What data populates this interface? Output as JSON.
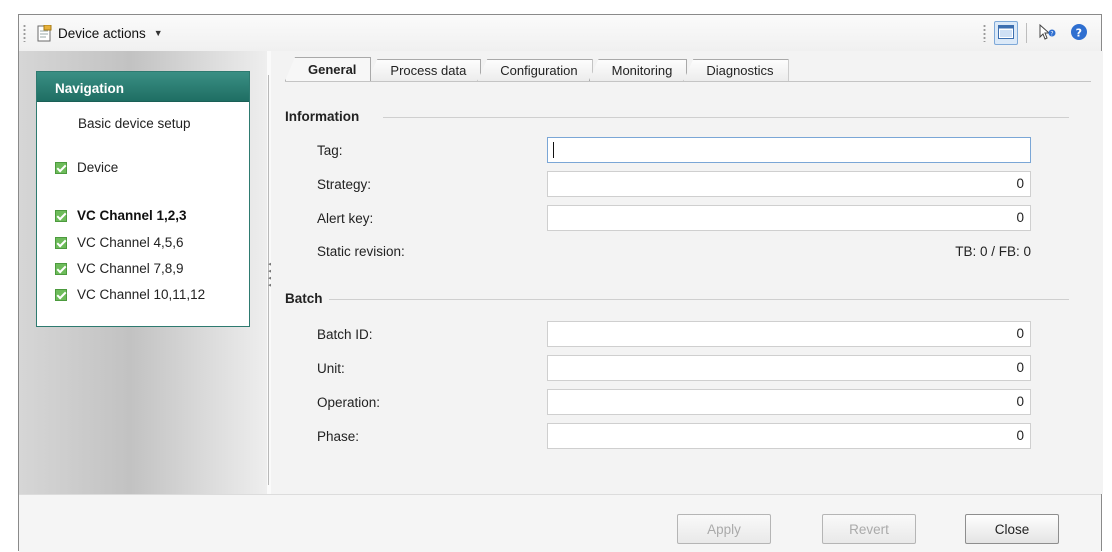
{
  "toolbar": {
    "device_actions_label": "Device actions",
    "device_actions_icon": "document-icon",
    "right_icons": [
      "window-layout-icon",
      "pointer-help-icon",
      "help-icon"
    ]
  },
  "navigation": {
    "title": "Navigation",
    "items": [
      {
        "label": "Basic device setup",
        "checked": false,
        "bold": false
      },
      {
        "label": "Device",
        "checked": true,
        "bold": false
      },
      {
        "label": "VC Channel 1,2,3",
        "checked": true,
        "bold": true
      },
      {
        "label": "VC Channel 4,5,6",
        "checked": true,
        "bold": false
      },
      {
        "label": "VC Channel 7,8,9",
        "checked": true,
        "bold": false
      },
      {
        "label": "VC Channel 10,11,12",
        "checked": true,
        "bold": false
      }
    ]
  },
  "tabs": [
    {
      "label": "General",
      "active": true
    },
    {
      "label": "Process data",
      "active": false
    },
    {
      "label": "Configuration",
      "active": false
    },
    {
      "label": "Monitoring",
      "active": false
    },
    {
      "label": "Diagnostics",
      "active": false
    }
  ],
  "information": {
    "title": "Information",
    "tag_label": "Tag:",
    "tag_value": "",
    "strategy_label": "Strategy:",
    "strategy_value": "0",
    "alert_key_label": "Alert key:",
    "alert_key_value": "0",
    "static_revision_label": "Static revision:",
    "static_revision_value": "TB: 0 / FB: 0"
  },
  "batch": {
    "title": "Batch",
    "batch_id_label": "Batch ID:",
    "batch_id_value": "0",
    "unit_label": "Unit:",
    "unit_value": "0",
    "operation_label": "Operation:",
    "operation_value": "0",
    "phase_label": "Phase:",
    "phase_value": "0"
  },
  "footer": {
    "apply_label": "Apply",
    "revert_label": "Revert",
    "close_label": "Close"
  },
  "colors": {
    "nav_header": "#2a8074",
    "check_green": "#6dbb5a",
    "focus_border": "#7aa6d6",
    "help_blue": "#2f6fd0"
  }
}
